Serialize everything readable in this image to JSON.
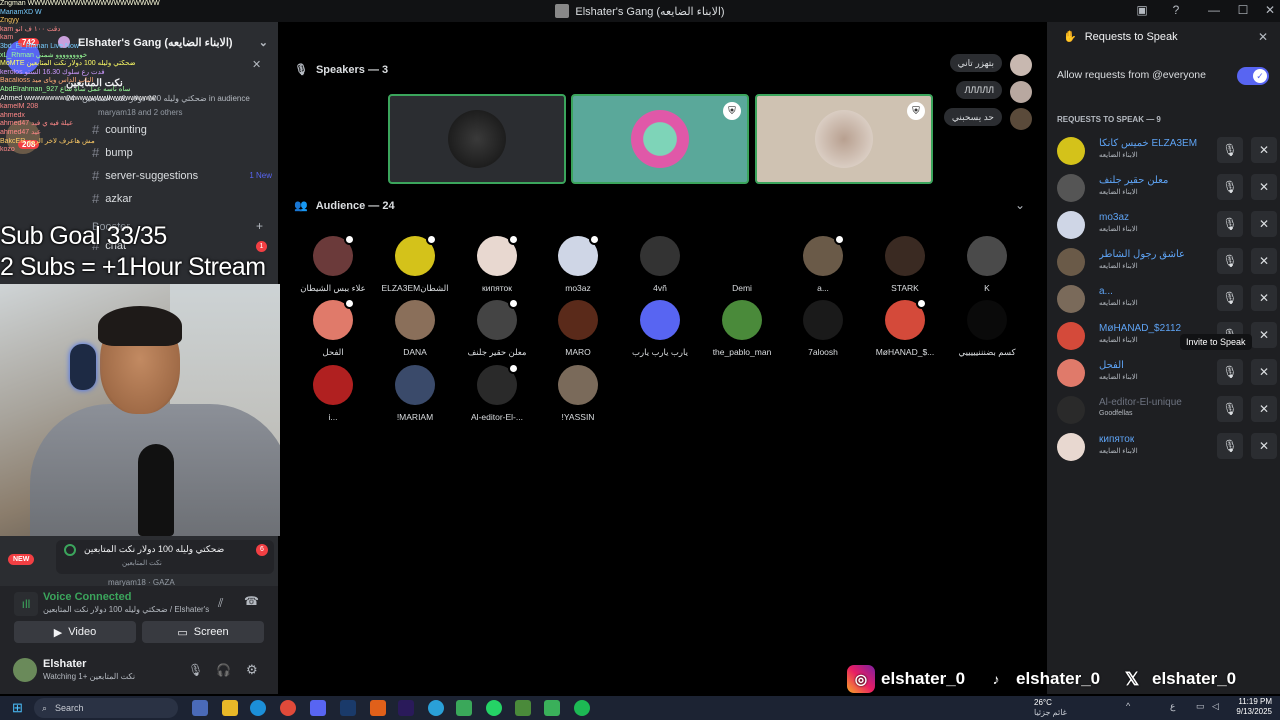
{
  "window": {
    "title": "Elshater's Gang (الابناء الضايعه)"
  },
  "overlay": {
    "chat_lines": [
      "Zngman WWWWWWWWWWWWWWWWWWWW",
      "MariamXD  W",
      "Zngyy",
      "kam  دقت ١٠٠ ف انو",
      "kam",
      "3bd_El_Rhman  Live Now",
      "xL_Rhman  خوووووووو شمني",
      "MoMTE  ضحكتي وليله 100 دولار نكت المتابعين",
      "kerolos  فدت رع سلوك 16.30 الستو",
      "Bacalioss  الناب الداس وياى ميد",
      "AbdElrahman_927  ساه ناسه عمل ساه ساع",
      "Ahmed  wwwwwwwwwwwwwwwwwwwwwwwwww",
      "kamelM  208",
      "ahmedx",
      "ahmed47  عيلة فيه ي فيد",
      "ahmed47  عيد",
      "BakcER  مش هاعرف لاخر الروم",
      "kozo"
    ],
    "goal_line1": "Sub Goal 33/35",
    "goal_line2": "2 Subs = +1Hour Stream",
    "badge_742": "742",
    "badge_208": "208"
  },
  "sidebar": {
    "server_name": "Elshater's Gang (الابناء الضايعه)",
    "event_title": "نكت المتابعين",
    "event_sub": "ضحكتي وليله 100 دولار نكت المتابعين",
    "event_audience": "24 in audience",
    "event_users": "maryam18 and 2 others",
    "channels": [
      {
        "label": "counting",
        "new": ""
      },
      {
        "label": "bump",
        "new": ""
      },
      {
        "label": "server-suggestions",
        "new": "1 New"
      },
      {
        "label": "azkar",
        "new": ""
      }
    ],
    "booster_label": "Booster",
    "chat_label": "chat",
    "chat_count": "1",
    "stage_card_title": "ضحكتي وليله 100 دولار نكت المتابعين",
    "stage_card_sub": "نكت المتابعين",
    "stage_card_count": "6",
    "new_badge": "NEW",
    "stage_card_users": "maryam18",
    "stage_card_tag": "GAZA",
    "voice_status": "Voice Connected",
    "voice_sub": "ضحكتي وليله 100 دولار نكت المتابعين / Elshater's...",
    "video_label": "Video",
    "screen_label": "Screen",
    "user_name": "Elshater",
    "user_status": "Watching نكت المتابعين +1"
  },
  "stage": {
    "speakers_title": "Speakers — 3",
    "audience_title": "Audience — 24",
    "speaker_pills": [
      "بتهزر تاني",
      "ЛЛЛЛЛ",
      "حد يسحبني"
    ],
    "audience": [
      {
        "name": "علاء ببس الشيطان",
        "color": "#6b3a3a",
        "dot": true
      },
      {
        "name": "ELZA3EMالشطان",
        "color": "#d4c21a",
        "dot": true
      },
      {
        "name": "кипяток",
        "color": "#e8d8d0",
        "dot": true
      },
      {
        "name": "mo3az",
        "color": "#cfd6e6",
        "dot": true
      },
      {
        "name": "4vñ",
        "color": "#333333",
        "dot": false
      },
      {
        "name": "Demi",
        "color": "#000000",
        "dot": false
      },
      {
        "name": "a...",
        "color": "#6a5a48",
        "dot": true
      },
      {
        "name": "STARK",
        "color": "#3a2a22",
        "dot": false
      },
      {
        "name": "K",
        "color": "#4a4a4a",
        "dot": false
      },
      {
        "name": "الفحل",
        "color": "#e07a6a",
        "dot": true
      },
      {
        "name": "DANA",
        "color": "#8a6f5a",
        "dot": false
      },
      {
        "name": "معلن حقير جلنف",
        "color": "#444444",
        "dot": true
      },
      {
        "name": "MARO",
        "color": "#5a2a1a",
        "dot": false
      },
      {
        "name": "يارب يارب يارب",
        "color": "#5865f2",
        "dot": false
      },
      {
        "name": "the_pablo_man",
        "color": "#4a8a3a",
        "dot": false
      },
      {
        "name": "7aloosh",
        "color": "#1a1a1a",
        "dot": false
      },
      {
        "name": "MøHANAD_$...",
        "color": "#d44a3a",
        "dot": true
      },
      {
        "name": "كسم بضنننيييييي",
        "color": "#0a0a0a",
        "dot": false
      },
      {
        "name": "i...",
        "color": "#b02020",
        "dot": false
      },
      {
        "name": "!MARIAM",
        "color": "#3a4a6a",
        "dot": false
      },
      {
        "name": "Al-editor-El-...",
        "color": "#2a2a2a",
        "dot": true
      },
      {
        "name": "!YASSIN",
        "color": "#7a6a5a",
        "dot": false
      }
    ]
  },
  "requests": {
    "title": "Requests to Speak",
    "allow_label": "Allow requests from @everyone",
    "list_title": "REQUESTS TO SPEAK — 9",
    "tooltip": "Invite to Speak",
    "items": [
      {
        "name": "خميس كانكا ELZA3EM",
        "sub": "الابناء الضايعه",
        "color": "#d4c21a",
        "dim": false
      },
      {
        "name": "معلن حقير جلنف",
        "sub": "الابناء الضايعه",
        "color": "#555555",
        "dim": false
      },
      {
        "name": "mo3az",
        "sub": "الابناء الضايعه",
        "color": "#cfd6e6",
        "dim": false
      },
      {
        "name": "عاشق رجول الشاطر",
        "sub": "الابناء الضايعه",
        "color": "#6a5a48",
        "dim": false
      },
      {
        "name": "a...",
        "sub": "الابناء الضايعه",
        "color": "#7a6a5a",
        "dim": false
      },
      {
        "name": "MøHANAD_$2112",
        "sub": "الابناء الضايعه",
        "color": "#d44a3a",
        "dim": false
      },
      {
        "name": "الفحل",
        "sub": "الابناء الضايعه",
        "color": "#e07a6a",
        "dim": false
      },
      {
        "name": "Al-editor-El-unique",
        "sub": "Goodfellas",
        "color": "#2a2a2a",
        "dim": true
      },
      {
        "name": "кипяток",
        "sub": "الابناء الضايعه",
        "color": "#e8d8d0",
        "dim": false
      }
    ]
  },
  "socials": {
    "instagram": "elshater_0",
    "tiktok": "elshater_0",
    "x": "elshater_0"
  },
  "taskbar": {
    "search": "Search",
    "temp": "26°C",
    "weather": "غائم جزئيا",
    "time": "11:19 PM",
    "date": "9/13/2025",
    "lang": "ع"
  }
}
